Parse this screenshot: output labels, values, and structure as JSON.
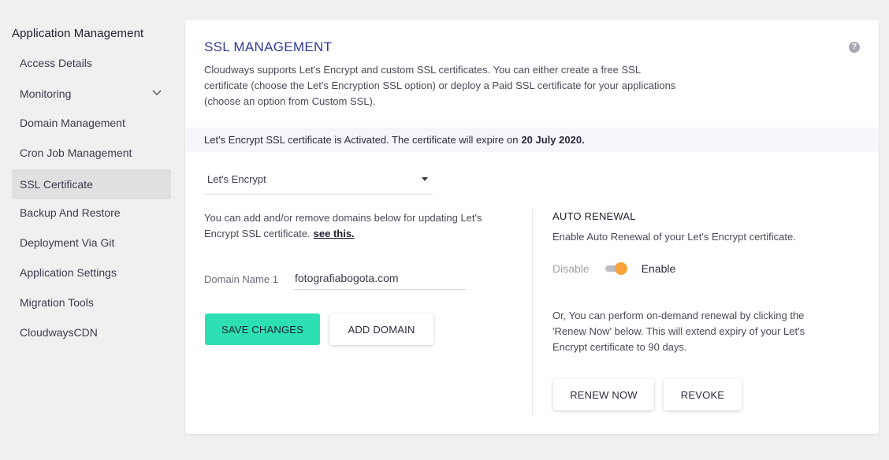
{
  "sidebar": {
    "title": "Application Management",
    "items": [
      {
        "label": "Access Details"
      },
      {
        "label": "Monitoring"
      },
      {
        "label": "Domain Management"
      },
      {
        "label": "Cron Job Management"
      },
      {
        "label": "SSL Certificate"
      },
      {
        "label": "Backup And Restore"
      },
      {
        "label": "Deployment Via Git"
      },
      {
        "label": "Application Settings"
      },
      {
        "label": "Migration Tools"
      },
      {
        "label": "CloudwaysCDN"
      }
    ],
    "active_item": "SSL Certificate",
    "icons": {
      "monitoring_chevron": "chevron-down-icon"
    }
  },
  "main": {
    "title": "SSL MANAGEMENT",
    "help_icon": "question-circle-icon",
    "help_glyph": "?",
    "description": "Cloudways supports Let's Encrypt and custom SSL certificates. You can either create a free SSL certificate (choose the Let's Encryption SSL option) or deploy a Paid SSL certificate for your applications (choose an option from Custom SSL).",
    "status": {
      "text": "Let's Encrypt SSL certificate is Activated. The certificate will expire on",
      "date": "20 July 2020."
    },
    "ssl_select": {
      "value": "Let's Encrypt",
      "icon": "caret-down-icon"
    },
    "domains": {
      "info": "You can add and/or remove domains below for updating Let's Encrypt SSL certificate.",
      "link": "see this.",
      "field_label": "Domain Name 1",
      "field_value": "fotografiabogota.com"
    },
    "buttons": {
      "save": "SAVE CHANGES",
      "add_domain": "ADD DOMAIN"
    },
    "auto_renewal": {
      "title": "AUTO RENEWAL",
      "description": "Enable Auto Renewal of your Let's Encrypt certificate.",
      "toggle_off_label": "Disable",
      "toggle_on_label": "Enable",
      "enabled": true,
      "note": "Or, You can perform on-demand renewal by clicking the 'Renew Now' below. This will extend expiry of your Let's Encrypt certificate to 90 days.",
      "renew_button": "RENEW NOW",
      "revoke_button": "REVOKE"
    }
  },
  "colors": {
    "accent": "#2ce0b4",
    "title": "#2f3a96",
    "toggle": "#f6a33a",
    "background": "#f0f0f0"
  }
}
